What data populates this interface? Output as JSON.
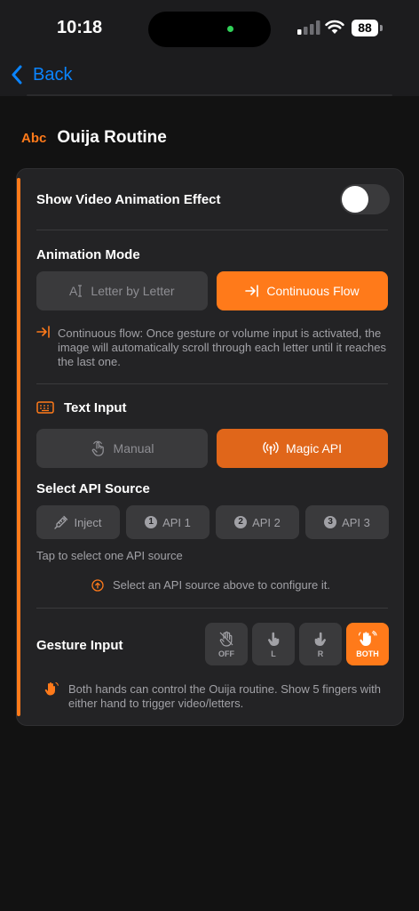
{
  "status": {
    "time": "10:18",
    "battery": "88"
  },
  "nav": {
    "back_label": "Back"
  },
  "section": {
    "badge": "Abc",
    "title": "Ouija Routine"
  },
  "card": {
    "video_effect_label": "Show Video Animation Effect",
    "video_effect_on": false,
    "animation_mode": {
      "label": "Animation Mode",
      "option_letter": "Letter by Letter",
      "option_continuous": "Continuous Flow",
      "selected": "Continuous Flow",
      "note": "Continuous flow: Once gesture or volume input is activated, the image will automatically scroll through each letter until it reaches the last one."
    },
    "text_input": {
      "label": "Text Input",
      "option_manual": "Manual",
      "option_magic": "Magic API",
      "selected": "Magic API"
    },
    "api_source": {
      "label": "Select API Source",
      "options": [
        {
          "num": "",
          "label": "Inject"
        },
        {
          "num": "1",
          "label": "API 1"
        },
        {
          "num": "2",
          "label": "API 2"
        },
        {
          "num": "3",
          "label": "API 3"
        }
      ],
      "hint": "Tap to select one API source",
      "configure_hint": "Select an API source above to configure it."
    },
    "gesture_input": {
      "label": "Gesture Input",
      "options": [
        "OFF",
        "L",
        "R",
        "BOTH"
      ],
      "selected": "BOTH",
      "note": "Both hands can control the Ouija routine. Show 5 fingers with either hand to trigger video/letters."
    }
  },
  "colors": {
    "accent": "#ff7a1a",
    "link": "#0a84ff",
    "card": "#232325"
  }
}
